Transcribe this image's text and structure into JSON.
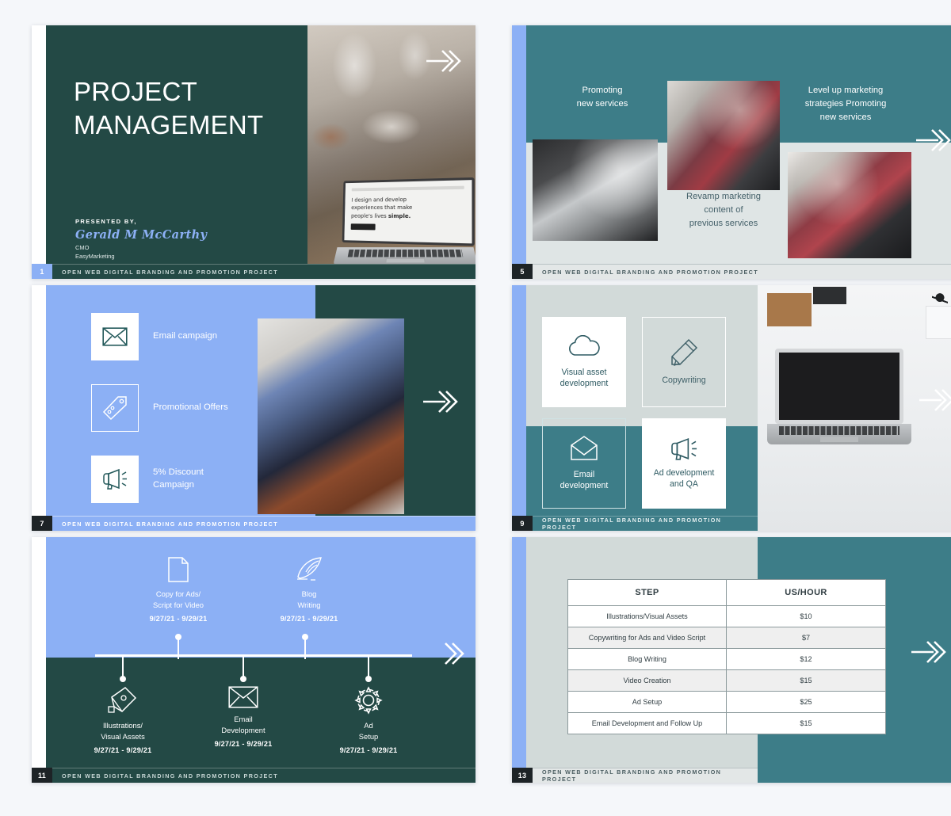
{
  "deck": {
    "footer_text": "OPEN WEB DIGITAL BRANDING AND PROMOTION PROJECT",
    "colors": {
      "dark_green": "#234945",
      "teal": "#3d7d88",
      "light_blue": "#8cb0f5",
      "pale_grey": "#d2dad9",
      "page_bg": "#f5f7fa"
    }
  },
  "slides": [
    {
      "number": "1",
      "name": "title-slide",
      "title_line1": "PROJECT",
      "title_line2": "MANAGEMENT",
      "presented_by_label": "PRESENTED BY,",
      "presenter_name": "Gerald M McCarthy",
      "presenter_role": "CMO",
      "presenter_company": "EasyMarketing",
      "laptop_quote_line1": "I design and develop",
      "laptop_quote_line2": "experiences that make",
      "laptop_quote_line3a": "people's lives ",
      "laptop_quote_line3b": "simple.",
      "footer": "OPEN WEB DIGITAL BRANDING AND PROMOTION PROJECT",
      "next_arrow": "arrow-right-icon"
    },
    {
      "number": "5",
      "name": "services-photo-grid-slide",
      "caption_top_left": "Promoting\nnew services",
      "caption_top_left_l1": "Promoting",
      "caption_top_left_l2": "new services",
      "caption_top_right_l1": "Level up marketing",
      "caption_top_right_l2": "strategies Promoting",
      "caption_top_right_l3": "new services",
      "caption_bottom_l1": "Revamp marketing",
      "caption_bottom_l2": "content of",
      "caption_bottom_l3": "previous services",
      "footer": "OPEN WEB DIGITAL BRANDING AND PROMOTION PROJECT",
      "next_arrow": "arrow-right-icon"
    },
    {
      "number": "7",
      "name": "campaign-list-slide",
      "items": [
        {
          "icon": "envelope-icon",
          "label": "Email campaign",
          "style": "filled"
        },
        {
          "icon": "tag-icon",
          "label": "Promotional Offers",
          "style": "outline"
        },
        {
          "icon": "megaphone-icon",
          "label_l1": "5% Discount",
          "label_l2": "Campaign",
          "style": "filled"
        }
      ],
      "footer": "OPEN WEB DIGITAL BRANDING AND PROMOTION PROJECT",
      "next_arrow": "arrow-right-icon"
    },
    {
      "number": "9",
      "name": "deliverables-cards-slide",
      "cards": [
        {
          "icon": "cloud-icon",
          "l1": "Visual asset",
          "l2": "development",
          "style": "white"
        },
        {
          "icon": "pencil-icon",
          "l1": "Copywriting",
          "l2": "",
          "style": "outline"
        },
        {
          "icon": "open-envelope-icon",
          "l1": "Email",
          "l2": "development",
          "style": "outline-on-teal"
        },
        {
          "icon": "megaphone-icon",
          "l1": "Ad development",
          "l2": "and QA",
          "style": "white"
        }
      ],
      "footer": "OPEN WEB DIGITAL BRANDING AND PROMOTION PROJECT",
      "next_arrow": "arrow-right-icon"
    },
    {
      "number": "11",
      "name": "timeline-slide",
      "top_items": [
        {
          "icon": "document-icon",
          "l1": "Copy for Ads/",
          "l2": "Script for Video",
          "date": "9/27/21 - 9/29/21"
        },
        {
          "icon": "feather-quill-icon",
          "l1": "Blog",
          "l2": "Writing",
          "date": "9/27/21 - 9/29/21"
        }
      ],
      "bottom_items": [
        {
          "icon": "pen-nib-icon",
          "l1": "Illustrations/",
          "l2": "Visual Assets",
          "date": "9/27/21 - 9/29/21"
        },
        {
          "icon": "envelope-icon",
          "l1": "Email",
          "l2": "Development",
          "date": "9/27/21 - 9/29/21"
        },
        {
          "icon": "gear-icon",
          "l1": "Ad",
          "l2": "Setup",
          "date": "9/27/21 - 9/29/21"
        }
      ],
      "footer": "OPEN WEB DIGITAL BRANDING AND PROMOTION PROJECT",
      "next_arrow": "arrow-right-icon"
    },
    {
      "number": "13",
      "name": "pricing-table-slide",
      "table": {
        "headers": [
          "STEP",
          "US/HOUR"
        ],
        "rows": [
          [
            "Illustrations/Visual Assets",
            "$10"
          ],
          [
            "Copywriting for Ads and Video Script",
            "$7"
          ],
          [
            "Blog Writing",
            "$12"
          ],
          [
            "Video Creation",
            "$15"
          ],
          [
            "Ad Setup",
            "$25"
          ],
          [
            "Email Development and Follow Up",
            "$15"
          ]
        ]
      },
      "footer": "OPEN WEB DIGITAL BRANDING AND PROMOTION PROJECT",
      "next_arrow": "arrow-right-icon"
    }
  ]
}
